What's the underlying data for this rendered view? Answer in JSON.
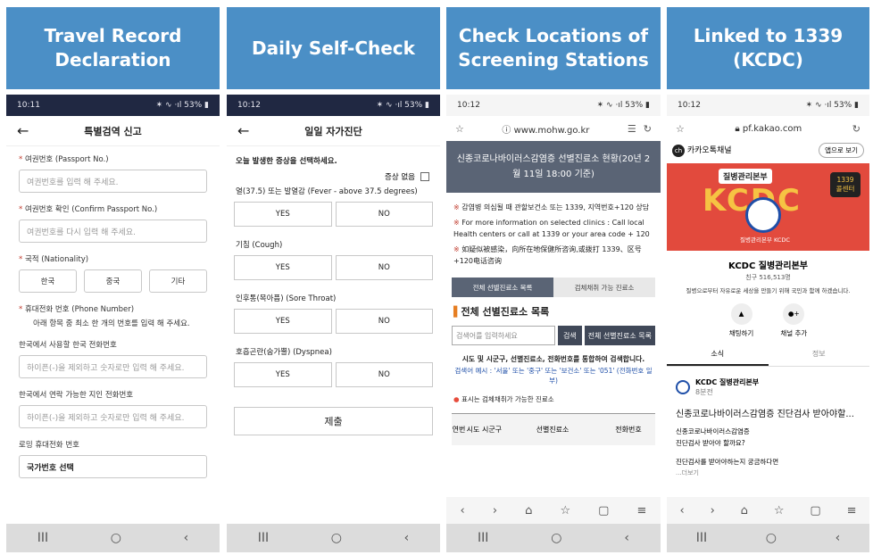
{
  "headers": [
    "Travel Record Declaration",
    "Daily Self-Check",
    "Check Locations of Screening Stations",
    "Linked to 1339 (KCDC)"
  ],
  "p1": {
    "time": "10:11",
    "status_right": "✶ ∿ ·ıl 53% ▮",
    "title": "특별검역 신고",
    "passport_label": "여권번호 (Passport No.)",
    "passport_ph": "여권번호를 입력 해 주세요.",
    "confirm_label": "여권번호 확인 (Confirm Passport No.)",
    "confirm_ph": "여권번호를 다시 입력 해 주세요.",
    "nat_label": "국적 (Nationality)",
    "nat_opts": [
      "한국",
      "중국",
      "기타"
    ],
    "phone_label": "휴대전화 번호 (Phone Number)",
    "phone_note": "아래 항목 중 최소 한 개의 번호를 입력 해 주세요.",
    "kr_label": "한국에서 사용할 한국 전화번호",
    "kr_ph": "하이픈(-)을 제외하고 숫자로만 입력 해 주세요.",
    "friend_label": "한국에서 연락 가능한 지인 전화번호",
    "friend_ph": "하이픈(-)을 제외하고 숫자로만 입력 해 주세요.",
    "roam_label": "로밍 휴대전화 번호",
    "roam_val": "국가번호 선택"
  },
  "p2": {
    "time": "10:12",
    "status_right": "✶ ∿ ·ıl 53% ▮",
    "title": "일일 자가진단",
    "prompt": "오늘 발생한 증상을 선택하세요.",
    "none": "증상 없음",
    "questions": [
      "열(37.5) 또는 발열감 (Fever - above 37.5 degrees)",
      "기침 (Cough)",
      "인후통(목아픔) (Sore Throat)",
      "호흡곤란(숨가뿔) (Dyspnea)"
    ],
    "yes": "YES",
    "no": "NO",
    "submit": "제출"
  },
  "p3": {
    "time": "10:12",
    "status_right": "✶ ∿ ·ıl 53% ▮",
    "url": "www.mohw.go.kr",
    "banner": "신종코로나바이러스감염증 선별진료소 현황(20년 2월 11일 18:00 기준)",
    "note1": "감염병 의심될 때 관할보건소 또는 1339, 지역번호+120 상담",
    "note2": "For more information on selected clinics : Call local Health centers or call at 1339 or your area code + 120",
    "note3": "如疑似被感染，向所在地保健所咨询,或拨打 1339、区号+120电话咨询",
    "tab1": "전체 선별진료소 목록",
    "tab2": "검체채취 가능 진료소",
    "section": "전체 선별진료소 목록",
    "search_ph": "검색어를 입력하세요",
    "search_btn": "검색",
    "all_btn": "전체 선별진료소 목록",
    "info": "시도 및 시군구, 선별진료소, 전화번호를 통합하여 검색합니다.",
    "example": "검색어 예시 : '서울' 또는 '중구' 또는 '보건소' 또는 '051' (전화번호 일부)",
    "legend": "표시는 검체채취가 가능한 진료소",
    "cols": [
      "연번",
      "시도",
      "시군구",
      "선별진료소",
      "전화번호"
    ]
  },
  "p4": {
    "time": "10:12",
    "status_right": "✶ ∿ ·ıl 53% ▮",
    "url": "pf.kakao.com",
    "channel": "카카오톡채널",
    "open_app": "앱으로 보기",
    "banner_title": "질병관리본부",
    "banner_word": "KCDC",
    "badge": "1339 콜센터",
    "logo_cap": "질병관리본부 KCDC",
    "name": "KCDC 질병관리본부",
    "friends": "친구 516,513명",
    "desc": "질병으로부터 자유로운 세상을 만들기 위해 국민과 함께 하겠습니다.",
    "chat": "채팅하기",
    "add": "채널 추가",
    "tab_news": "소식",
    "tab_info": "정보",
    "post_author": "KCDC 질병관리본부",
    "post_time": "8분전",
    "post_title": "신종코로나바이러스감염증 진단검사 받아야할...",
    "post_l1": "신종코로나바이러스감염증",
    "post_l2": "진단검사 받아야 할까요?",
    "post_l3": "진단검사를 받아야하는지 궁금하다면",
    "more": "...더보기"
  },
  "navbar": [
    "III",
    "○",
    "‹"
  ]
}
